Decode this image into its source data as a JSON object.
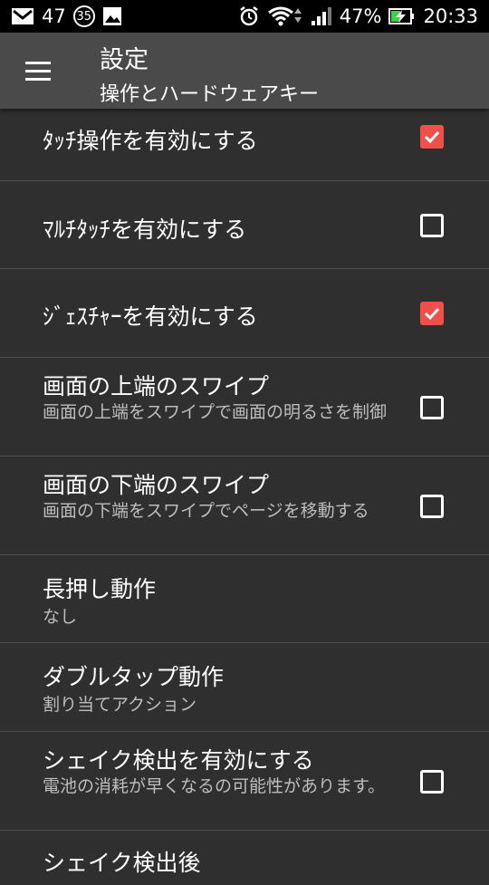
{
  "status_bar": {
    "count": "47",
    "badge": "35",
    "battery": "47%",
    "time": "20:33",
    "icons": [
      "mail-icon",
      "image-icon",
      "alarm-icon",
      "wifi-icon",
      "signal-icon",
      "battery-charging-icon"
    ]
  },
  "app_bar": {
    "title": "設定",
    "subtitle": "操作とハードウェアキー",
    "menu_icon": "hamburger-menu-icon"
  },
  "settings": [
    {
      "title": "ﾀｯﾁ操作を有効にする",
      "summary": "",
      "checkbox": true,
      "checked": true
    },
    {
      "title": "ﾏﾙﾁﾀｯﾁを有効にする",
      "summary": "",
      "checkbox": true,
      "checked": false
    },
    {
      "title": "ｼﾞｪｽﾁｬｰを有効にする",
      "summary": "",
      "checkbox": true,
      "checked": true
    },
    {
      "title": "画面の上端のスワイプ",
      "summary": "画面の上端をスワイプで画面の明るさを制御",
      "checkbox": true,
      "checked": false
    },
    {
      "title": "画面の下端のスワイプ",
      "summary": "画面の下端をスワイプでページを移動する",
      "checkbox": true,
      "checked": false
    },
    {
      "title": "長押し動作",
      "summary": "なし",
      "checkbox": false,
      "checked": false
    },
    {
      "title": "ダブルタップ動作",
      "summary": "割り当てアクション",
      "checkbox": false,
      "checked": false
    },
    {
      "title": "シェイク検出を有効にする",
      "summary": "電池の消耗が早くなるの可能性があります。",
      "checkbox": true,
      "checked": false
    },
    {
      "title": "シェイク検出後",
      "summary": "",
      "checkbox": false,
      "checked": false
    }
  ],
  "colors": {
    "background": "#2f2f2f",
    "app_bar": "#4a4a4a",
    "accent": "#f0504a",
    "divider": "#4c4c4c"
  }
}
